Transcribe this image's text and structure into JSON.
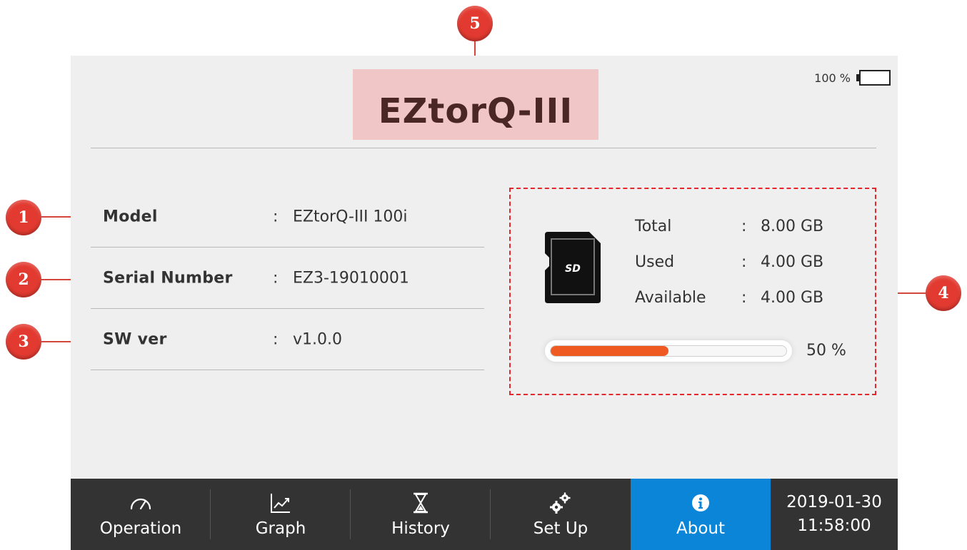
{
  "header": {
    "title": "EZtorQ-III",
    "battery_percent": "100 %",
    "battery_level": 1.0,
    "battery_color": "#2db84a"
  },
  "device_info": [
    {
      "label": "Model",
      "colon": ":",
      "value": "EZtorQ-III 100i"
    },
    {
      "label": "Serial Number",
      "colon": ":",
      "value": "EZ3-19010001"
    },
    {
      "label": "SW ver",
      "colon": ":",
      "value": "v1.0.0"
    }
  ],
  "storage": {
    "icon": "sd-card-icon",
    "sd_logo_text": "SD",
    "rows": [
      {
        "label": "Total",
        "colon": ":",
        "value": "8.00 GB"
      },
      {
        "label": "Used",
        "colon": ":",
        "value": "4.00 GB"
      },
      {
        "label": "Available",
        "colon": ":",
        "value": "4.00 GB"
      }
    ],
    "usage_fraction": 0.5,
    "usage_percent": "50 %",
    "bar_color": "#ee5a22"
  },
  "navbar": {
    "items": [
      {
        "label": "Operation",
        "icon": "gauge-icon",
        "active": false
      },
      {
        "label": "Graph",
        "icon": "line-chart-icon",
        "active": false
      },
      {
        "label": "History",
        "icon": "hourglass-icon",
        "active": false
      },
      {
        "label": "Set Up",
        "icon": "gears-icon",
        "active": false
      },
      {
        "label": "About",
        "icon": "info-icon",
        "active": true
      }
    ],
    "date": "2019-01-30",
    "time": "11:58:00",
    "active_color": "#0a85d8"
  },
  "callouts": [
    "1",
    "2",
    "3",
    "4",
    "5"
  ],
  "colors": {
    "callout": "#e23a30",
    "title_highlight": "#f1c6c6",
    "storage_border": "#e5262b"
  }
}
